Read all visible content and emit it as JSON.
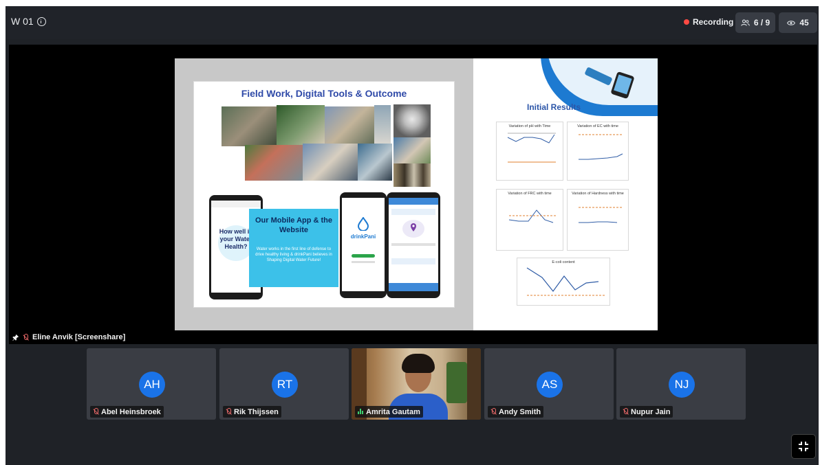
{
  "meeting": {
    "title": "W 01"
  },
  "status": {
    "recording_label": "Recording",
    "participants_count": "6 / 9",
    "viewers_count": "45",
    "recording_color": "#ff4a43"
  },
  "screenshare": {
    "presenter_label": "Eline Anvik [Screenshare]",
    "slide": {
      "left_title": "Field Work, Digital Tools & Outcome",
      "mobile_heading": "Our Mobile App & the Website",
      "mobile_text": "Water works in the first line of defense to drive healthy living & drinkPani believes in Shaping Digital Water Future!",
      "phone1_text": "How well is your Water Health?",
      "phone2_brand": "drinkPani",
      "right_title": "Initial Results",
      "charts": [
        "Variation of pH with Time",
        "Variation of EC with time",
        "Variation of FRC with time",
        "Variation of Hardness with time",
        "E-coli content"
      ]
    }
  },
  "participants": [
    {
      "initials": "AH",
      "name": "Abel Heinsbroek",
      "muted": true
    },
    {
      "initials": "RT",
      "name": "Rik Thijssen",
      "muted": true
    },
    {
      "initials": "",
      "name": "Amrita Gautam",
      "muted": false
    },
    {
      "initials": "AS",
      "name": "Andy Smith",
      "muted": true
    },
    {
      "initials": "NJ",
      "name": "Nupur Jain",
      "muted": true
    }
  ],
  "icons": {
    "info": "info-icon",
    "record": "record-dot-icon",
    "participants": "participants-icon",
    "viewers": "eye-icon",
    "pin": "pin-icon",
    "mic_off": "mic-off-icon",
    "speaking": "speaking-icon",
    "exit_fullscreen": "exit-fullscreen-icon"
  },
  "colors": {
    "avatar": "#1a73e8",
    "accent_blue": "#2f4aa8",
    "mobile_band": "#3cc1e9"
  }
}
